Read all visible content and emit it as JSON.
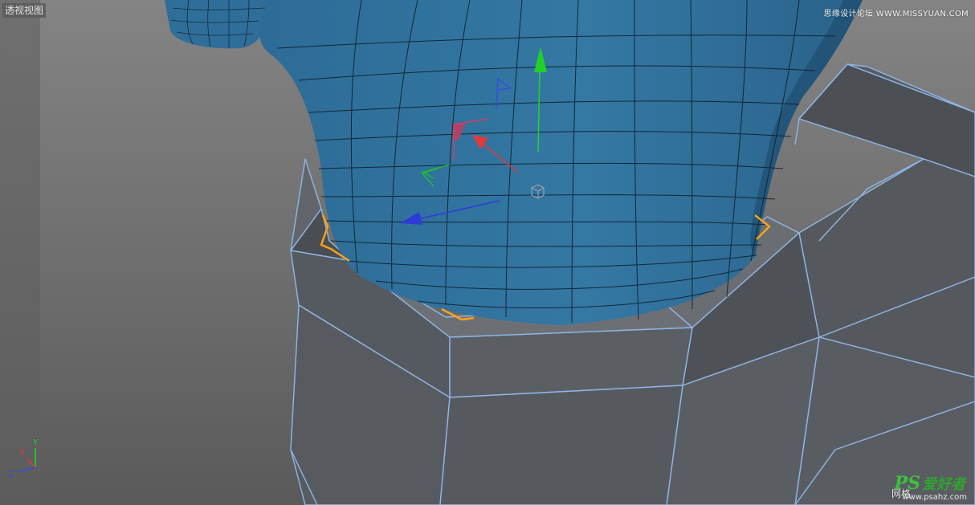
{
  "viewport": {
    "view_label": "透视视图",
    "grid_label": "网格"
  },
  "watermarks": {
    "top_right": "思缘设计论坛 WWW.MISSYUAN.COM",
    "ps_logo": "PS",
    "ps_cn": "爱好者",
    "ps_url": "www.psahz.com"
  },
  "axis_gizmo": {
    "x_label": "X",
    "y_label": "Y",
    "z_label": "Z"
  },
  "colors": {
    "background_top": "#7c7c7c",
    "background_bottom": "#5e5e5e",
    "mesh_blue": "#2f6f9a",
    "cube_gray": "#4f5358",
    "wire_edge": "#8fb6e8",
    "selection_orange": "#ffa21a",
    "gizmo_x": "#e03a3a",
    "gizmo_y": "#22d02a",
    "gizmo_z": "#2e3ad8"
  }
}
